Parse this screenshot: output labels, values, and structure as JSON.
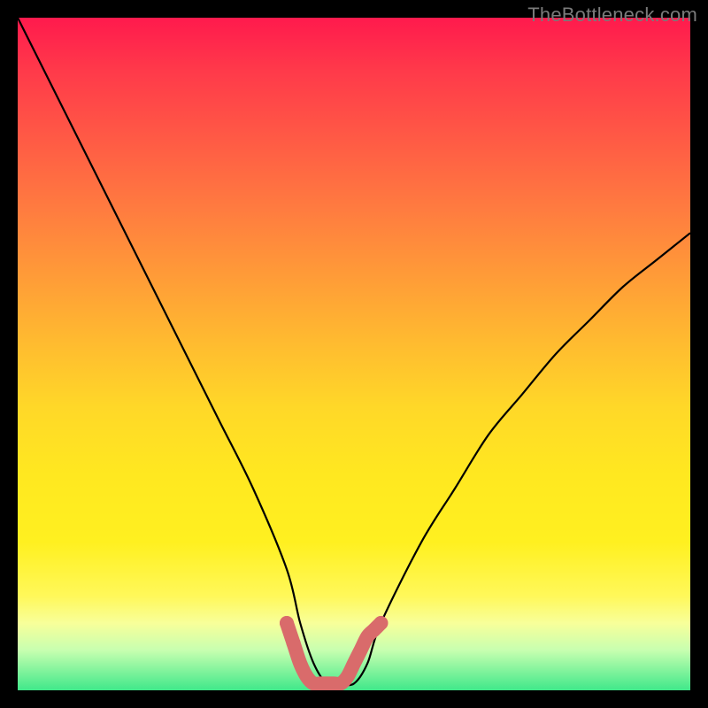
{
  "watermark": "TheBottleneck.com",
  "chart_data": {
    "type": "line",
    "title": "",
    "xlabel": "",
    "ylabel": "",
    "xlim": [
      0,
      100
    ],
    "ylim": [
      0,
      100
    ],
    "series": [
      {
        "name": "bottleneck-curve",
        "x": [
          0,
          5,
          10,
          15,
          20,
          25,
          30,
          35,
          40,
          42,
          44,
          46,
          48,
          50,
          52,
          54,
          60,
          65,
          70,
          75,
          80,
          85,
          90,
          95,
          100
        ],
        "values": [
          100,
          90,
          80,
          70,
          60,
          50,
          40,
          30,
          18,
          10,
          4,
          1,
          1,
          1,
          4,
          10,
          22,
          30,
          38,
          44,
          50,
          55,
          60,
          64,
          68
        ]
      },
      {
        "name": "emphasis-dots",
        "x": [
          40,
          41,
          42,
          43,
          44,
          45,
          46,
          47,
          48,
          49,
          50,
          51,
          52,
          53,
          54
        ],
        "values": [
          10,
          7,
          4,
          2,
          1,
          1,
          1,
          1,
          1,
          2,
          4,
          6,
          8,
          9,
          10
        ]
      }
    ],
    "colors": {
      "curve": "#000000",
      "dots": "#d96b6b",
      "gradient_top": "#ff1a4d",
      "gradient_bottom": "#40e88a",
      "frame": "#000000"
    }
  }
}
